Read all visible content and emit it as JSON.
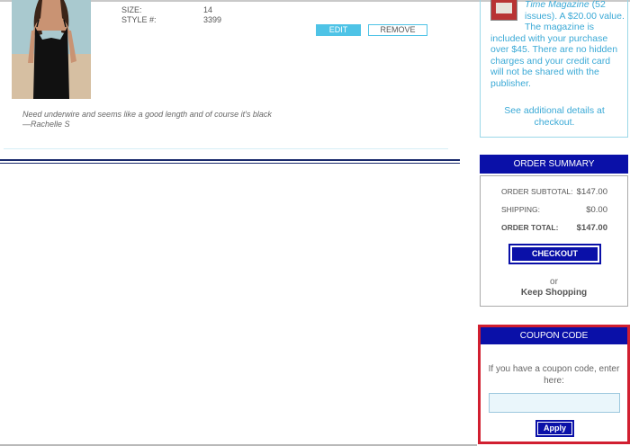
{
  "cart_item": {
    "size_label": "SIZE:",
    "size_value": "14",
    "style_label": "STYLE #:",
    "style_value": "3399",
    "edit_label": "EDIT",
    "remove_label": "REMOVE",
    "review_text": "Need underwire and seems like a good length and of course it's black",
    "review_author": "—Rachelle S"
  },
  "promo": {
    "line1": "Time Magazine",
    "line1_rest": " (52",
    "line2": "issues). A $20.00 value.",
    "line3": "The magazine is",
    "body": "included with your purchase over $45. There are no hidden charges and your credit card will not be shared with the publisher.",
    "details_link": "See additional details at checkout."
  },
  "order_summary": {
    "title": "ORDER SUMMARY",
    "subtotal_label": "ORDER SUBTOTAL:",
    "subtotal_value": "$147.00",
    "shipping_label": "SHIPPING:",
    "shipping_value": "$0.00",
    "total_label": "ORDER TOTAL:",
    "total_value": "$147.00",
    "checkout_label": "CHECKOUT",
    "or_text": "or",
    "keep_shopping": "Keep Shopping"
  },
  "coupon": {
    "title": "COUPON CODE",
    "prompt": "If you have a coupon code, enter here:",
    "input_value": "",
    "apply_label": "Apply"
  },
  "colors": {
    "accent_navy": "#0a10a8",
    "accent_cyan": "#4ec3e6",
    "highlight_red": "#d11f30",
    "link_blue": "#3aa9d6"
  }
}
